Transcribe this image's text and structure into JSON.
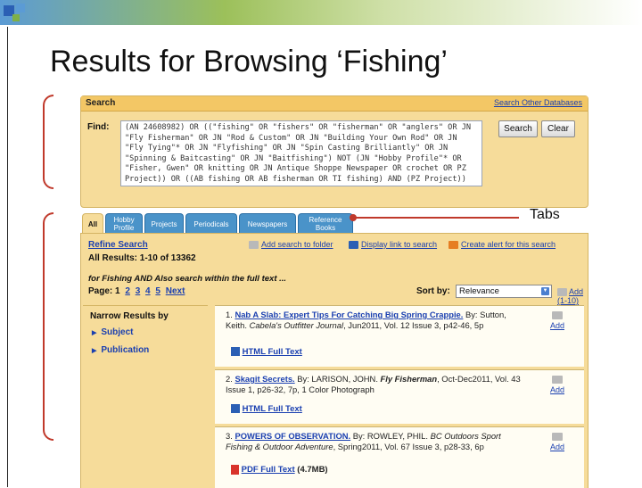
{
  "slide": {
    "title": "Results for Browsing ‘Fishing’",
    "tabs_callout": "Tabs"
  },
  "search": {
    "header": "Search",
    "other_db_link": "Search Other Databases",
    "find_label": "Find:",
    "query": "(AN 24608982) OR ((\"fishing\" OR \"fishers\" OR \"fisherman\" OR \"anglers\" OR JN \"Fly Fisherman\" OR JN \"Rod & Custom\" OR JN \"Building Your Own Rod\" OR JN \"Fly Tying\"* OR JN \"Flyfishing\" OR JN \"Spin Casting Brilliantly\" OR JN \"Spinning & Baitcasting\" OR JN \"Baitfishing\") NOT (JN \"Hobby Profile\"* OR \"Fisher, Gwen\" OR knitting OR JN Antique Shoppe Newspaper OR crochet OR PZ Project)) OR ((AB fishing OR AB fisherman OR TI fishing) AND (PZ Project))",
    "search_btn": "Search",
    "clear_btn": "Clear"
  },
  "tabs": [
    {
      "label": "All",
      "active": true
    },
    {
      "label": "Hobby Profile",
      "active": false
    },
    {
      "label": "Projects",
      "active": false
    },
    {
      "label": "Periodicals",
      "active": false
    },
    {
      "label": "Newspapers",
      "active": false
    },
    {
      "label": "Reference Books",
      "active": false
    }
  ],
  "results": {
    "refine": "Refine Search",
    "all_results": "All Results: 1-10 of 13362",
    "add_search_folder": "Add search to folder",
    "display_link": "Display link to search",
    "create_alert": "Create alert for this search",
    "for_line": "for Fishing AND Also search within the full text ...",
    "page_label": "Page: 1",
    "pages": [
      "2",
      "3",
      "4",
      "5"
    ],
    "next": "Next",
    "sort_label": "Sort by:",
    "sort_value": "Relevance",
    "add_range": "Add (1-10)"
  },
  "narrow": {
    "heading": "Narrow Results by",
    "items": [
      "Subject",
      "Publication"
    ]
  },
  "items": [
    {
      "num": "1.",
      "title": "Nab A Slab: Expert Tips For Catching Big Spring Crappie.",
      "by": "By: Sutton, Keith. ",
      "source": "Cabela's Outfitter Journal",
      "rest": ", Jun2011, Vol. 12 Issue 3, p42-46, 5p",
      "fulltext": "HTML Full Text",
      "size": "",
      "add": "Add"
    },
    {
      "num": "2.",
      "title": "Skagit Secrets.",
      "by": " By: LARISON, JOHN. ",
      "source": "Fly Fisherman",
      "rest": ", Oct-Dec2011, Vol. 43 Issue 1, p26-32, 7p, 1 Color Photograph",
      "fulltext": "HTML Full Text",
      "size": "",
      "add": "Add"
    },
    {
      "num": "3.",
      "title": "POWERS OF OBSERVATION.",
      "by": " By: ROWLEY, PHIL. ",
      "source": "BC Outdoors Sport Fishing & Outdoor Adventure",
      "rest": ", Spring2011, Vol. 67 Issue 3, p28-33, 6p",
      "fulltext": "PDF Full Text",
      "size": "(4.7MB)",
      "add": "Add"
    }
  ],
  "colors": {
    "accent_red": "#c0392b",
    "panel": "#f6dc9a",
    "tab_blue": "#4a93c9",
    "link_blue": "#1a3fb0"
  }
}
